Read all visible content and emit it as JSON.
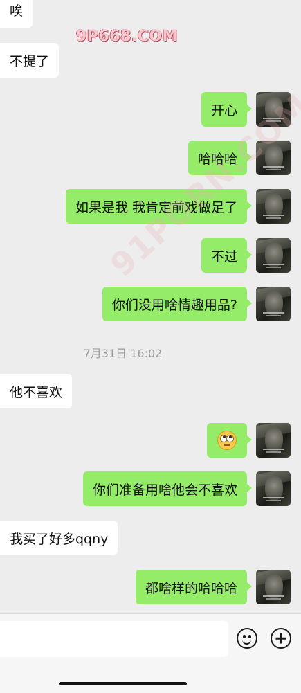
{
  "watermark": {
    "top": "9P668.COM",
    "diagonal": "91PORN.COM"
  },
  "messages": [
    {
      "side": "left",
      "text": "唉"
    },
    {
      "side": "left",
      "text": "不提了"
    },
    {
      "side": "right",
      "text": "开心"
    },
    {
      "side": "right",
      "text": "哈哈哈"
    },
    {
      "side": "right",
      "text": "如果是我 我肯定前戏做足了"
    },
    {
      "side": "right",
      "text": "不过"
    },
    {
      "side": "right",
      "text": "你们没用啥情趣用品?"
    },
    {
      "side": "left",
      "text": "他不喜欢"
    },
    {
      "side": "right",
      "text": "",
      "emoji": "eye-roll-face"
    },
    {
      "side": "right",
      "text": "你们准备用啥他会不喜欢"
    },
    {
      "side": "left",
      "text": "我买了好多qqny"
    },
    {
      "side": "right",
      "text": "都啥样的哈哈哈"
    }
  ],
  "timestamp": "7月31日 16:02",
  "input_bar": {
    "emoji_icon": "smile-icon",
    "plus_icon": "plus-icon"
  },
  "colors": {
    "sent_bubble": "#95ec69",
    "received_bubble": "#ffffff",
    "background": "#ededed"
  }
}
